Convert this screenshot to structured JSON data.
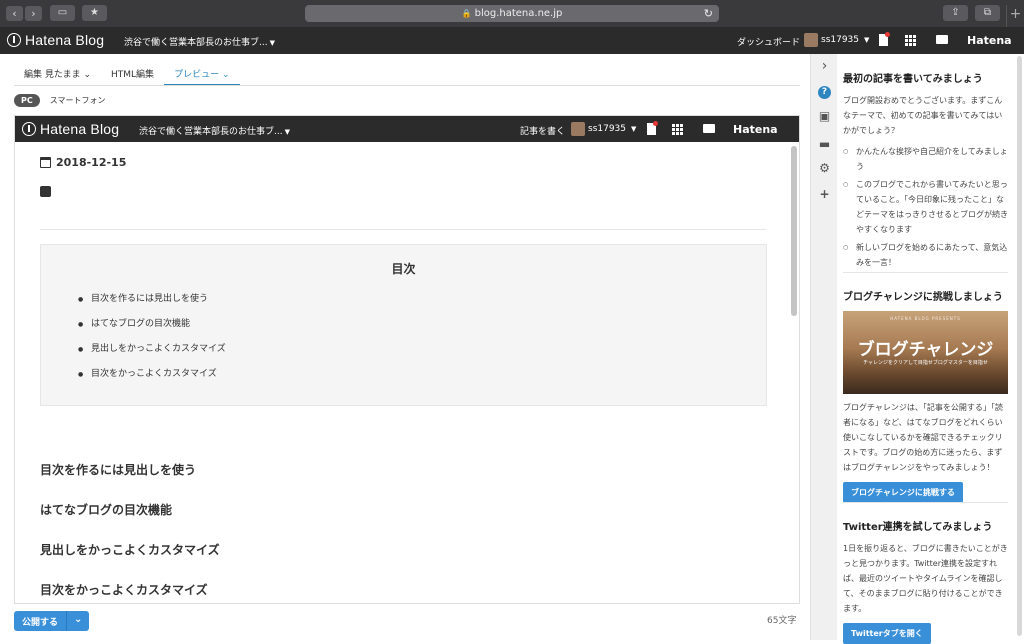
{
  "browser": {
    "back": "‹",
    "forward": "›",
    "url": "blog.hatena.ne.jp"
  },
  "topbar": {
    "logo": "Hatena Blog",
    "blog_name": "渋谷で働く営業本部長のお仕事ブ...",
    "dashboard": "ダッシュボード",
    "user": "ss17935",
    "hatena": "Hatena"
  },
  "editor": {
    "tabs": [
      {
        "label": "編集 見たまま"
      },
      {
        "label": "HTML編集"
      },
      {
        "label": "プレビュー"
      }
    ],
    "devices": {
      "pc": "PC",
      "smartphone": "スマートフォン"
    }
  },
  "preview": {
    "bar": {
      "logo": "Hatena Blog",
      "blog_name": "渋谷で働く営業本部長のお仕事ブ...",
      "write": "記事を書く",
      "user": "ss17935",
      "hatena": "Hatena"
    },
    "date": "2018-12-15",
    "toc": {
      "title": "目次",
      "items": [
        "目次を作るには見出しを使う",
        "はてなブログの目次機能",
        "見出しをかっこよくカスタマイズ",
        "目次をかっこよくカスタマイズ"
      ]
    },
    "headings": [
      "目次を作るには見出しを使う",
      "はてなブログの目次機能",
      "見出しをかっこよくカスタマイズ",
      "目次をかっこよくカスタマイズ"
    ]
  },
  "bottom": {
    "publish": "公開する",
    "char_count": "65文字"
  },
  "sidebar_icons": [
    "chevron-right-icon",
    "help-icon",
    "image-icon",
    "folder-icon",
    "gear-icon",
    "plus-icon"
  ],
  "panel": {
    "first": {
      "title": "最初の記事を書いてみましょう",
      "text": "ブログ開設おめでとうございます。まずこんなテーマで、初めての記事を書いてみてはいかがでしょう？",
      "items": [
        "かんたんな挨拶や自己紹介をしてみましょう",
        "このブログでこれから書いてみたいと思っていること。「今日印象に残ったこと」などテーマをはっきりさせるとブログが続きやすくなります",
        "新しいブログを始めるにあたって、意気込みを一言！"
      ]
    },
    "challenge": {
      "title": "ブログチャレンジに挑戦しましょう",
      "img_small": "HATENA BLOG PRESENTS",
      "img_big": "ブログチャレンジ",
      "img_sub": "チャレンジをクリアして目指せブログマスターを目指せ",
      "text": "ブログチャレンジは、「記事を公開する」「読者になる」など、はてなブログをどれくらい使いこなしているかを確認できるチェックリストです。ブログの始め方に迷ったら、まずはブログチャレンジをやってみましょう！",
      "button": "ブログチャレンジに挑戦する"
    },
    "twitter": {
      "title": "Twitter連携を試してみましょう",
      "text": "1日を振り返ると、ブログに書きたいことがきっと見つかります。Twitter連携を設定すれば、最近のツイートやタイムラインを確認して、そのままブログに貼り付けることができます。",
      "button": "Twitterタブを開く"
    }
  },
  "colors": {
    "accent": "#2e86c1",
    "button": "#3a8fd9",
    "dark_bar": "#2b2b2b"
  }
}
